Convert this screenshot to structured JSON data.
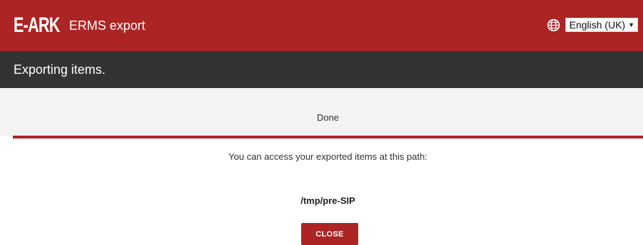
{
  "header": {
    "logo_text": "E-ARK",
    "app_title": "ERMS export",
    "language": {
      "icon": "globe-icon",
      "selected": "English (UK)"
    }
  },
  "subheader": {
    "title": "Exporting items."
  },
  "main": {
    "status": "Done",
    "info": "You can access your exported items at this path:",
    "path": "/tmp/pre-SIP",
    "close_label": "CLOSE"
  },
  "colors": {
    "brand_red": "#ac2424",
    "dark_bar": "#333333",
    "panel_grey": "#f3f3f3"
  }
}
